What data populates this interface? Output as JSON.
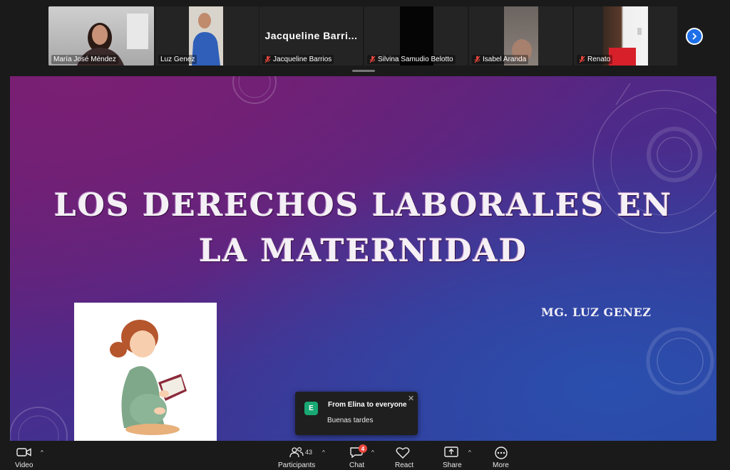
{
  "participants": [
    {
      "name": "María José Méndez",
      "muted": false,
      "active": true
    },
    {
      "name": "Luz Genez",
      "muted": false,
      "active": false
    },
    {
      "name": "Jacqueline Barrios",
      "display_name": "Jacqueline  Barri...",
      "muted": true,
      "active": false
    },
    {
      "name": "Silvina Samudio Belotto",
      "muted": true,
      "active": false
    },
    {
      "name": "Isabel Aranda",
      "muted": true,
      "active": false
    },
    {
      "name": "Renato",
      "muted": true,
      "active": false
    }
  ],
  "slide": {
    "title_line1": "LOS DERECHOS LABORALES EN",
    "title_line2": "LA MATERNIDAD",
    "author": "MG. LUZ GENEZ"
  },
  "chat_toast": {
    "avatar_letter": "E",
    "from": "From Elina to everyone",
    "message": "Buenas tardes"
  },
  "toolbar": {
    "video_label": "Video",
    "participants_label": "Participants",
    "participants_count": "43",
    "chat_label": "Chat",
    "chat_badge": "4",
    "react_label": "React",
    "share_label": "Share",
    "more_label": "More"
  },
  "colors": {
    "active_speaker": "#3ecf8e",
    "next_button": "#1e6fe8",
    "badge": "#e8453c",
    "toast_avatar": "#19a974"
  }
}
